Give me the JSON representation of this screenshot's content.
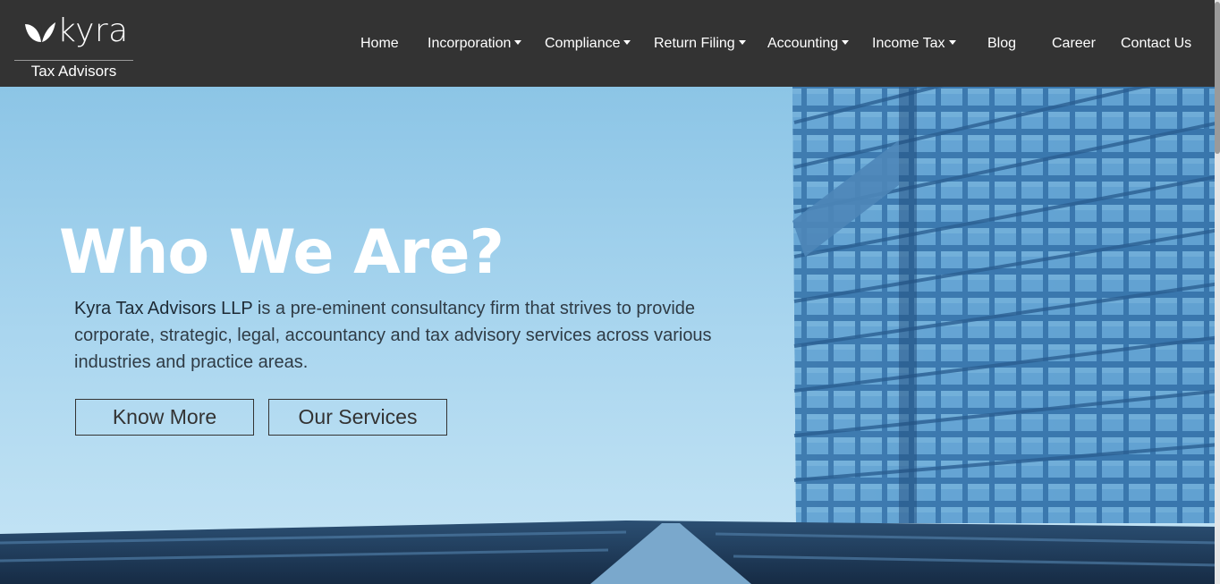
{
  "brand": {
    "name": "kyra",
    "tagline": "Tax Advisors"
  },
  "nav": {
    "items": [
      {
        "label": "Home",
        "dropdown": false
      },
      {
        "label": "Incorporation",
        "dropdown": true
      },
      {
        "label": "Compliance",
        "dropdown": true
      },
      {
        "label": "Return Filing",
        "dropdown": true
      },
      {
        "label": "Accounting",
        "dropdown": true
      },
      {
        "label": "Income Tax",
        "dropdown": true
      },
      {
        "label": "Blog",
        "dropdown": false
      },
      {
        "label": "Career",
        "dropdown": false
      },
      {
        "label": "Contact Us",
        "dropdown": false
      }
    ]
  },
  "hero": {
    "title": "Who We Are?",
    "company": "Kyra Tax Advisors LLP",
    "description": " is a pre-eminent consultancy firm that strives to provide corporate, strategic, legal, accountancy and tax advisory services across various industries and practice areas.",
    "buttons": {
      "know_more": "Know More",
      "our_services": "Our Services"
    }
  },
  "colors": {
    "navbar": "#333333",
    "sky": "#a9d4ec",
    "building_glass": "#3d7fb8",
    "button_border": "#333333"
  }
}
